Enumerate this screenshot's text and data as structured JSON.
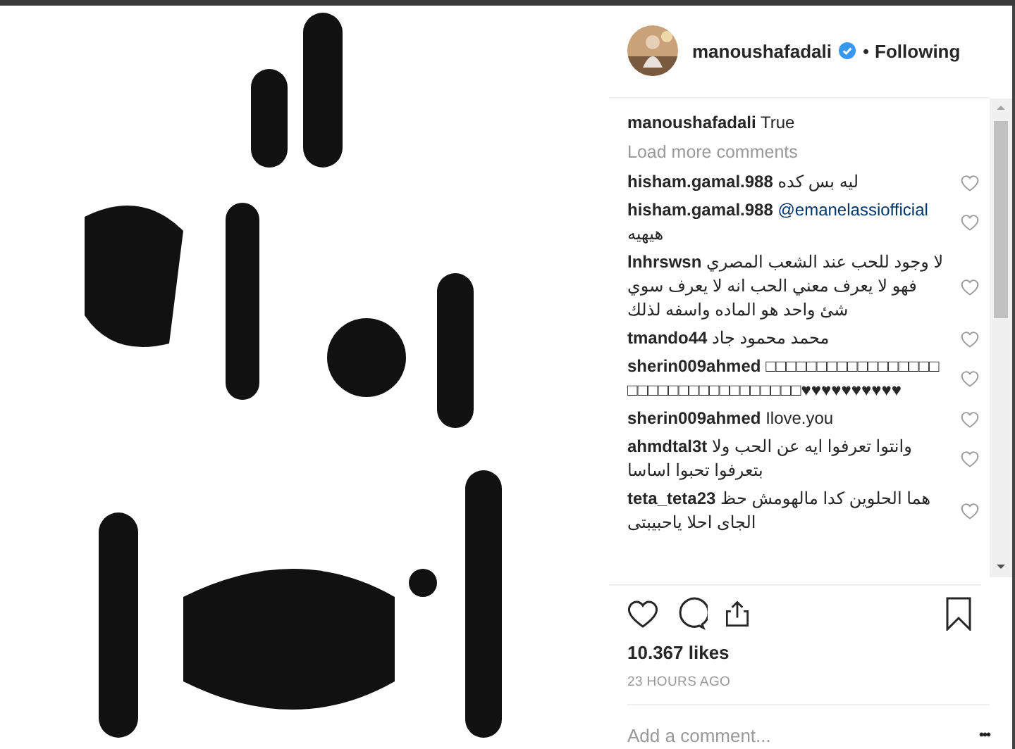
{
  "header": {
    "username": "manoushafadali",
    "verified": true,
    "separator": "•",
    "follow_label": "Following"
  },
  "caption": {
    "username": "manoushafadali",
    "text": "True"
  },
  "load_more": "Load more comments",
  "comments": [
    {
      "username": "hisham.gamal.988",
      "text": "ليه بس كده",
      "liked": false
    },
    {
      "username": "hisham.gamal.988",
      "mention": "@emanelassiofficial",
      "text": "هيهيه",
      "liked": false
    },
    {
      "username": "lnhrswsn",
      "text": "لا وجود للحب عند الشعب المصري فهو لا يعرف معني الحب انه لا يعرف سوي شئ واحد هو الماده واسفه لذلك",
      "liked": false
    },
    {
      "username": "tmando44",
      "text": "محمد محمود جاد",
      "liked": false
    },
    {
      "username": "sherin009ahmed",
      "text": "□□□□□□□□□□□□□□□□□□□□□□□□□□□□□□□□□□♥♥♥♥♥♥♥♥♥♥",
      "liked": false
    },
    {
      "username": "sherin009ahmed",
      "text": "Ilove.you",
      "liked": false
    },
    {
      "username": "ahmdtal3t",
      "text": "وانتوا تعرفوا ايه عن الحب ولا بتعرفوا تحبوا اساسا",
      "liked": false
    },
    {
      "username": "teta_teta23",
      "text": "هما الحلوين كدا مالهومش حظ الجاى احلا ياحبيبتى",
      "liked": false
    }
  ],
  "likes": "10.367 likes",
  "time": "23 HOURS AGO",
  "saved": false,
  "comment_field": {
    "placeholder": "Add a comment...",
    "more": "•••"
  }
}
